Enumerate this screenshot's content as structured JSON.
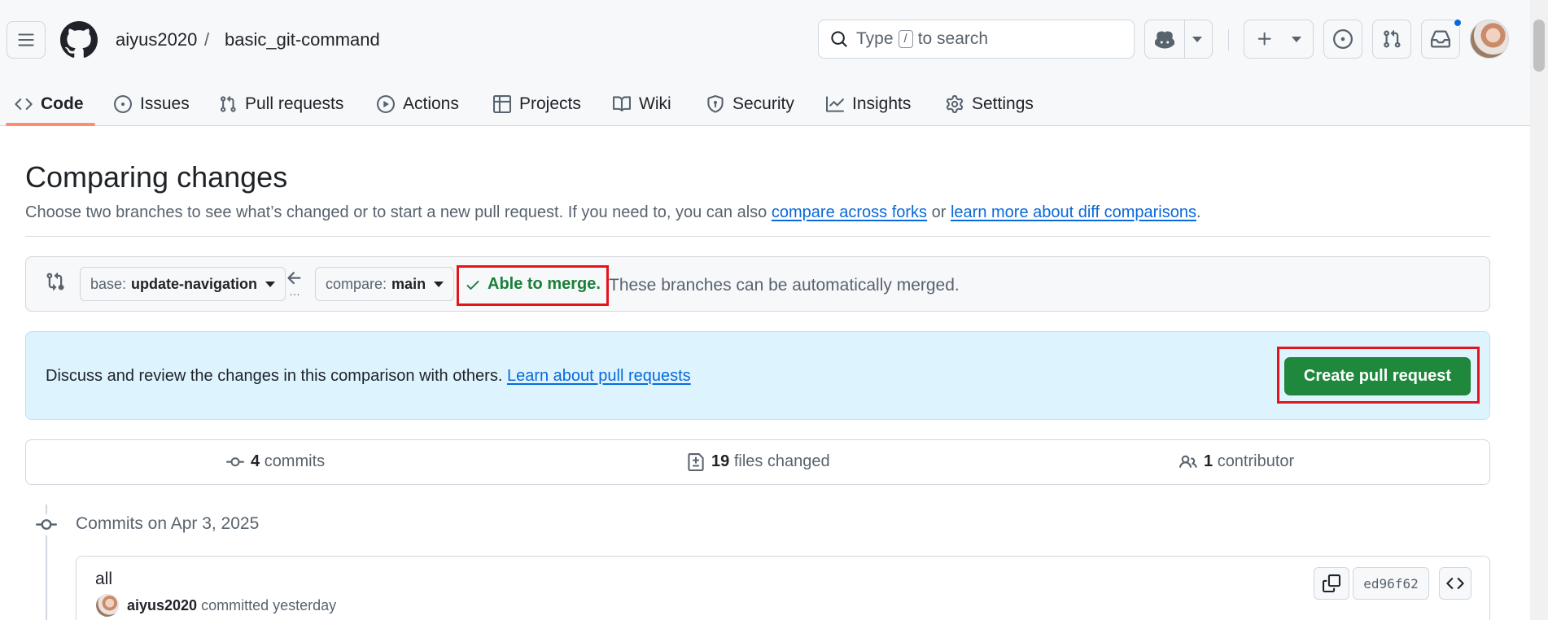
{
  "header": {
    "owner": "aiyus2020",
    "separator": "/",
    "repo": "basic_git-command",
    "search": {
      "prefix": "Type",
      "key": "/",
      "suffix": "to search"
    }
  },
  "tabs": [
    {
      "label": "Code",
      "icon": "code-icon",
      "active": true
    },
    {
      "label": "Issues",
      "icon": "issue-opened-icon"
    },
    {
      "label": "Pull requests",
      "icon": "git-pull-request-icon"
    },
    {
      "label": "Actions",
      "icon": "play-icon"
    },
    {
      "label": "Projects",
      "icon": "table-icon"
    },
    {
      "label": "Wiki",
      "icon": "book-icon"
    },
    {
      "label": "Security",
      "icon": "shield-icon"
    },
    {
      "label": "Insights",
      "icon": "graph-icon"
    },
    {
      "label": "Settings",
      "icon": "gear-icon"
    }
  ],
  "main": {
    "title": "Comparing changes",
    "intro": {
      "text": "Choose two branches to see what’s changed or to start a new pull request. If you need to, you can also",
      "link1": "compare across forks",
      "or": "or",
      "link2": "learn more about diff comparisons",
      "period": "."
    },
    "range": {
      "base_prefix": "base:",
      "base_branch": "update-navigation",
      "compare_prefix": "compare:",
      "compare_branch": "main",
      "merge_status": "Able to merge.",
      "merge_message": "These branches can be automatically merged."
    },
    "flash": {
      "text": "Discuss and review the changes in this comparison with others.",
      "link": "Learn about pull requests",
      "button": "Create pull request"
    },
    "stats": {
      "commits_count": "4",
      "commits_label": "commits",
      "files_count": "19",
      "files_label": "files changed",
      "contributors_count": "1",
      "contributors_label": "contributor"
    },
    "commits_header": "Commits on Apr 3, 2025",
    "commit": {
      "title": "all",
      "author": "aiyus2020",
      "meta": "committed yesterday",
      "sha": "ed96f62"
    }
  },
  "colors": {
    "accent_blue": "#0969da",
    "success_green": "#1f883d",
    "highlight_red": "#e5141b",
    "tab_underline": "#fd8c73"
  }
}
